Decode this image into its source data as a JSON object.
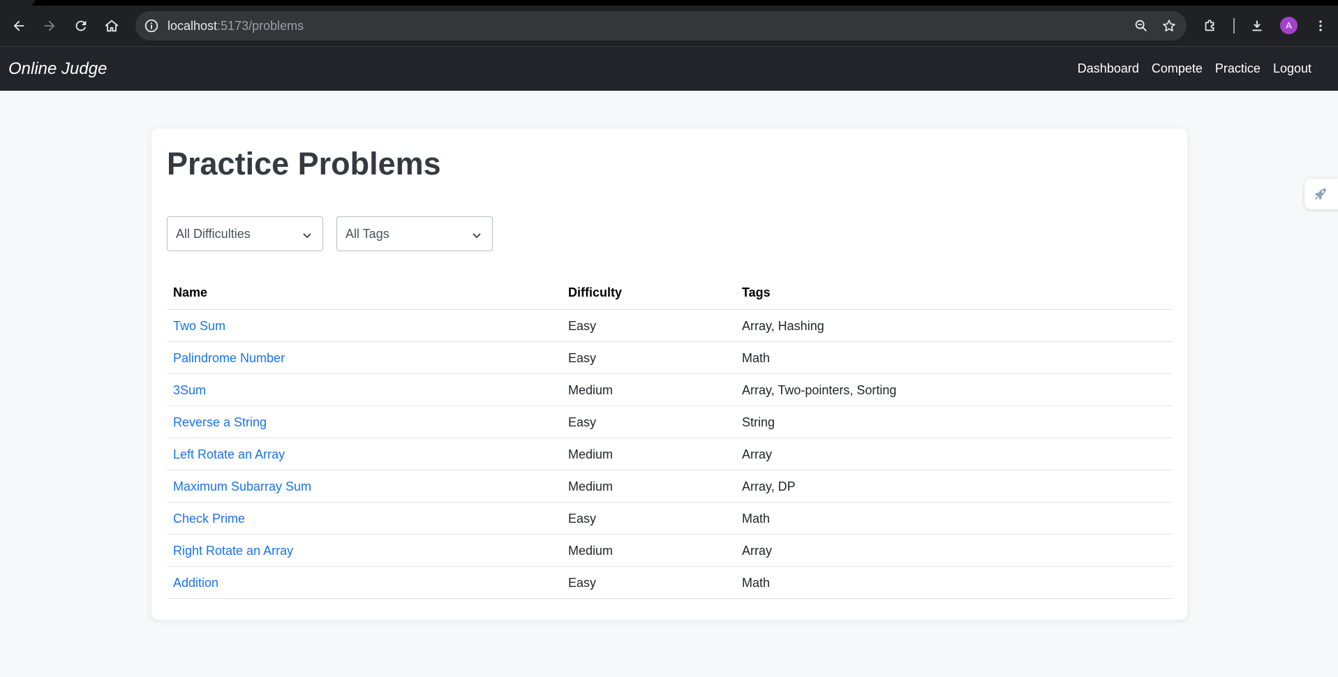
{
  "browser": {
    "url_host": "localhost",
    "url_path": ":5173/problems",
    "profile_initial": "A",
    "icons": [
      "back-icon",
      "forward-icon",
      "reload-icon",
      "home-icon",
      "site-info-icon",
      "zoom-icon",
      "bookmark-star-icon",
      "extensions-icon",
      "download-icon",
      "menu-kebab-icon"
    ]
  },
  "navbar": {
    "brand": "Online Judge",
    "links": [
      "Dashboard",
      "Compete",
      "Practice",
      "Logout"
    ]
  },
  "page": {
    "title": "Practice Problems",
    "filters": {
      "difficulty": "All Difficulties",
      "tags": "All Tags"
    }
  },
  "table": {
    "columns": [
      "Name",
      "Difficulty",
      "Tags"
    ],
    "rows": [
      {
        "name": "Two Sum",
        "difficulty": "Easy",
        "tags": "Array, Hashing"
      },
      {
        "name": "Palindrome Number",
        "difficulty": "Easy",
        "tags": "Math"
      },
      {
        "name": "3Sum",
        "difficulty": "Medium",
        "tags": "Array, Two-pointers, Sorting"
      },
      {
        "name": "Reverse a String",
        "difficulty": "Easy",
        "tags": "String"
      },
      {
        "name": "Left Rotate an Array",
        "difficulty": "Medium",
        "tags": "Array"
      },
      {
        "name": "Maximum Subarray Sum",
        "difficulty": "Medium",
        "tags": "Array, DP"
      },
      {
        "name": "Check Prime",
        "difficulty": "Easy",
        "tags": "Math"
      },
      {
        "name": "Right Rotate an Array",
        "difficulty": "Medium",
        "tags": "Array"
      },
      {
        "name": "Addition",
        "difficulty": "Easy",
        "tags": "Math"
      }
    ]
  },
  "colors": {
    "navbar_bg": "#212529",
    "link": "#1a73e8",
    "page_bg": "#f7f8fa",
    "avatar": "#a142c9"
  }
}
